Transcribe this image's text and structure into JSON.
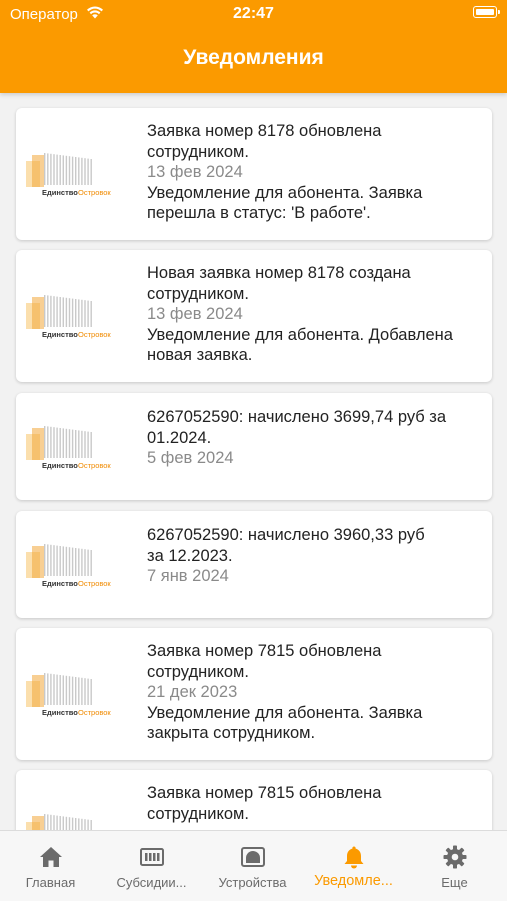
{
  "status_bar": {
    "carrier": "Оператор",
    "time": "22:47"
  },
  "header": {
    "title": "Уведомления"
  },
  "logo_text": {
    "part1": "Единство",
    "part2": "Островок"
  },
  "notifications": [
    {
      "title": "Заявка номер 8178 обновлена\nсотрудником.",
      "date": "13 фев 2024",
      "body": "Уведомление для абонента. Заявка\nперешла в статус: 'В работе'."
    },
    {
      "title": "Новая заявка номер 8178 создана\nсотрудником.",
      "date": "13 фев 2024",
      "body": "Уведомление для абонента. Добавлена\nновая заявка."
    },
    {
      "title": "6267052590: начислено 3699,74 руб за\n01.2024.",
      "date": "5 фев 2024",
      "body": ""
    },
    {
      "title": "6267052590: начислено 3960,33 руб\nза 12.2023.",
      "date": "7 янв 2024",
      "body": ""
    },
    {
      "title": "Заявка номер 7815 обновлена\nсотрудником.",
      "date": "21 дек 2023",
      "body": "Уведомление для абонента. Заявка\nзакрыта сотрудником."
    },
    {
      "title": "Заявка номер 7815 обновлена\nсотрудником.",
      "date": "",
      "body": ""
    }
  ],
  "tabs": [
    {
      "label": "Главная",
      "icon": "home-icon"
    },
    {
      "label": "Субсидии...",
      "icon": "meter-icon"
    },
    {
      "label": "Устройства",
      "icon": "device-icon"
    },
    {
      "label": "Уведомле...",
      "icon": "bell-icon"
    },
    {
      "label": "Еще",
      "icon": "gear-icon"
    }
  ],
  "colors": {
    "accent": "#fb9a00",
    "tab_inactive": "#6b6b6b",
    "date_gray": "#8a8a8a"
  }
}
